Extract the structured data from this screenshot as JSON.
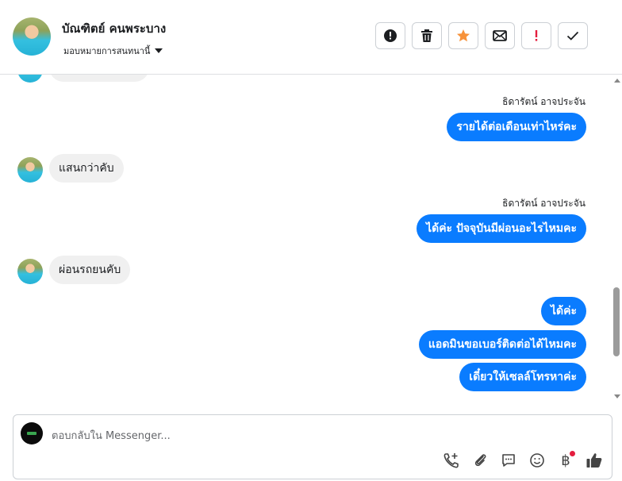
{
  "header": {
    "contact_name": "บัณฑิตย์ คนพระบาง",
    "assign_label": "มอบหมายการสนทนานี้"
  },
  "actions": [
    {
      "name": "report-button",
      "icon": "alert-icon"
    },
    {
      "name": "delete-button",
      "icon": "trash-icon"
    },
    {
      "name": "star-button",
      "icon": "star-icon",
      "color": "#f7923a"
    },
    {
      "name": "mark-unread-button",
      "icon": "envelope-icon"
    },
    {
      "name": "important-button",
      "icon": "exclamation-icon",
      "color": "#e41e3f"
    },
    {
      "name": "done-button",
      "icon": "check-icon"
    }
  ],
  "messages": {
    "sender_1": "ธิดารัตน์ อาจประจัน",
    "out_1": "รายได้ต่อเดือนเท่าไหร่คะ",
    "in_1": "แสนกว่าคับ",
    "sender_2": "ธิดารัตน์ อาจประจัน",
    "out_2": "ได้ค่ะ ปัจจุบันมีผ่อนอะไรไหมคะ",
    "in_2": "ผ่อนรถยนคับ",
    "out_3": "ได้ค่ะ",
    "out_4": "แอดมินขอเบอร์ติดต่อได้ไหมคะ",
    "out_5": "เดี๋ยวให้เซลล์โทรหาค่ะ"
  },
  "composer": {
    "placeholder": "ตอบกลับใน Messenger..."
  },
  "colors": {
    "outgoing_bubble": "#0a7cff",
    "incoming_bubble": "#f0f0f0",
    "notification_dot": "#e41e3f"
  }
}
